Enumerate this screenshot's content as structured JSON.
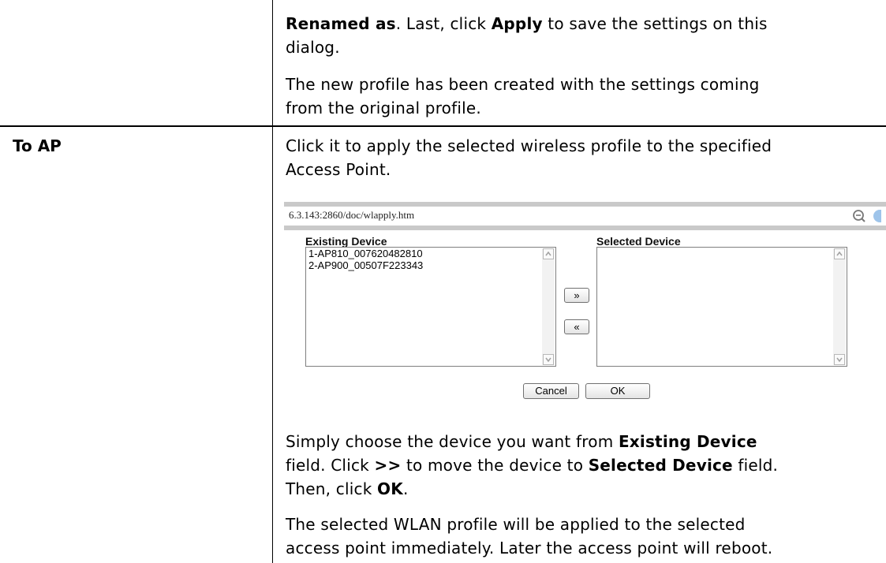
{
  "rows": {
    "prev": {
      "para1": {
        "b1": "Renamed as",
        "t1": ". Last, click ",
        "b2": "Apply",
        "t2": " to save the settings on this",
        "line2": "dialog."
      },
      "para2": {
        "line1": "The new profile has been created with the settings coming",
        "line2": "from the original profile."
      }
    },
    "to_ap": {
      "term": "To AP",
      "intro": {
        "line1": "Click it to apply the selected wireless profile to the specified",
        "line2": "Access Point."
      },
      "para3": {
        "t1": "Simply choose the device you want from ",
        "b1": "Existing Device",
        "t2": "field. Click ",
        "b2": ">>",
        "t3": " to move the device to ",
        "b3": "Selected Device",
        "t4": " field.",
        "t5": "Then, click ",
        "b4": "OK",
        "t6": "."
      },
      "para4": {
        "line1": "The selected WLAN profile will be applied to the selected",
        "line2": "access point immediately. Later the access point will reboot."
      }
    }
  },
  "dialog": {
    "url": "6.3.143:2860/doc/wlapply.htm",
    "existing_label": "Existing Device",
    "selected_label": "Selected Device",
    "existing_items": [
      "1-AP810_007620482810",
      "2-AP900_00507F223343"
    ],
    "move_right": "»",
    "move_left": "«",
    "cancel": "Cancel",
    "ok": "OK"
  }
}
